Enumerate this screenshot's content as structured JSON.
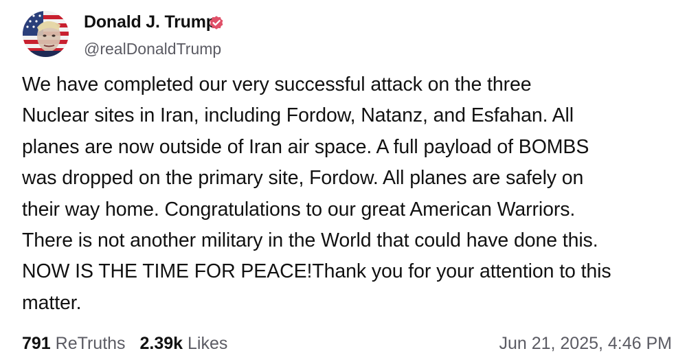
{
  "post": {
    "author": {
      "name": "Donald J. Trump",
      "handle": "@realDonaldTrump",
      "verified": true,
      "verified_color": "#e05068"
    },
    "body": "We have completed our very successful attack on the three\nNuclear sites in Iran, including Fordow, Natanz, and Esfahan. All\nplanes are now outside of Iran air space. A full payload of BOMBS\nwas dropped on the primary site, Fordow. All planes are safely on\ntheir way home. Congratulations to our great American Warriors.\nThere is not another military in the World that could have done this.\nNOW IS THE TIME FOR PEACE!Thank you for your attention to this\nmatter.",
    "stats": {
      "retruths_count": "791",
      "retruths_label": "ReTruths",
      "likes_count": "2.39k",
      "likes_label": "Likes"
    },
    "timestamp": "Jun 21, 2025, 4:46 PM"
  },
  "icons": {
    "avatar": "avatar-flag-portrait",
    "verified": "verified-badge-icon"
  }
}
